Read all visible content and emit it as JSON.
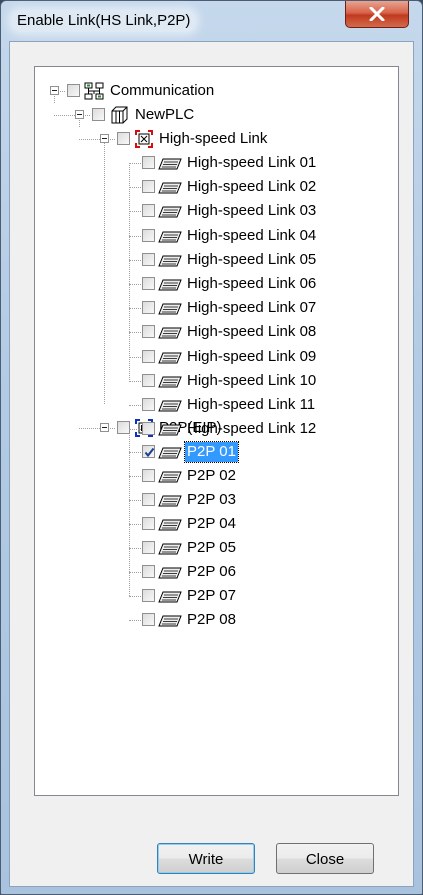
{
  "window": {
    "title": "Enable Link(HS Link,P2P)",
    "close_icon": "close-x-icon"
  },
  "tree": {
    "root": {
      "label": "Communication",
      "icon": "communication-icon",
      "checked": false
    },
    "plc": {
      "label": "NewPLC",
      "icon": "plc-icon",
      "checked": false
    },
    "hs_group": {
      "label": "High-speed Link",
      "icon": "hs-link-group-icon",
      "checked": false
    },
    "hs_items": [
      {
        "label": "High-speed Link 01",
        "checked": false
      },
      {
        "label": "High-speed Link 02",
        "checked": false
      },
      {
        "label": "High-speed Link 03",
        "checked": false
      },
      {
        "label": "High-speed Link 04",
        "checked": false
      },
      {
        "label": "High-speed Link 05",
        "checked": false
      },
      {
        "label": "High-speed Link 06",
        "checked": false
      },
      {
        "label": "High-speed Link 07",
        "checked": false
      },
      {
        "label": "High-speed Link 08",
        "checked": false
      },
      {
        "label": "High-speed Link 09",
        "checked": false
      },
      {
        "label": "High-speed Link 10",
        "checked": false
      },
      {
        "label": "High-speed Link 11",
        "checked": false
      },
      {
        "label": "High-speed Link 12",
        "checked": false
      }
    ],
    "p2p_group": {
      "label": "P2P(EIP)",
      "icon": "p2p-group-icon",
      "checked": false
    },
    "p2p_items": [
      {
        "label": "P2P 01",
        "checked": true,
        "selected": true
      },
      {
        "label": "P2P 02",
        "checked": false
      },
      {
        "label": "P2P 03",
        "checked": false
      },
      {
        "label": "P2P 04",
        "checked": false
      },
      {
        "label": "P2P 05",
        "checked": false
      },
      {
        "label": "P2P 06",
        "checked": false
      },
      {
        "label": "P2P 07",
        "checked": false
      },
      {
        "label": "P2P 08",
        "checked": false
      }
    ]
  },
  "buttons": {
    "write": "Write",
    "close": "Close"
  },
  "colors": {
    "selection": "#3399ff",
    "close_button": "#c03a20"
  }
}
